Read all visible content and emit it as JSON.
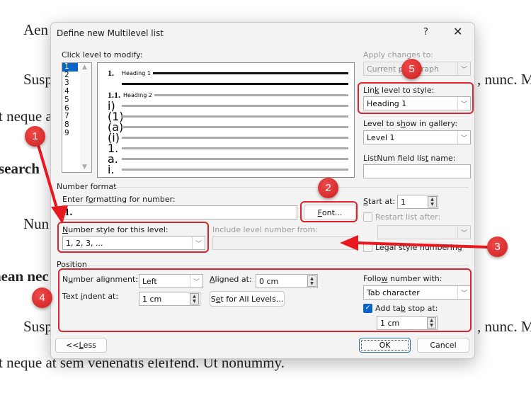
{
  "document": {
    "lines": [
      {
        "text": "Aen",
        "bold": false
      },
      {
        "text": "Susp",
        "bold": false
      },
      {
        "text": ", nunc. M",
        "bold": false
      },
      {
        "text": "t neque a",
        "bold": false
      },
      {
        "text": "search",
        "bold": true
      },
      {
        "text": "Nun",
        "bold": false
      },
      {
        "text": "nean nec",
        "bold": true
      },
      {
        "text": "Susp",
        "bold": false
      },
      {
        "text": ", nunc. M",
        "bold": false
      },
      {
        "text": "t neque at sem venenatis eleifend. Ut nonummy.",
        "bold": false
      }
    ]
  },
  "dialog": {
    "title": "Define new Multilevel list",
    "help_label": "?",
    "close_label": "✕",
    "click_level_label": "Click level to modify:",
    "levels": [
      "1",
      "2",
      "3",
      "4",
      "5",
      "6",
      "7",
      "8",
      "9"
    ],
    "selected_level": "1",
    "preview": [
      {
        "num": "1.",
        "text": "Heading 1",
        "bold": true
      },
      {
        "num": "1.1.",
        "text": "Heading 2",
        "bold": true
      },
      {
        "num": "i)",
        "text": ""
      },
      {
        "num": "(1)",
        "text": ""
      },
      {
        "num": "(a)",
        "text": ""
      },
      {
        "num": "(i)",
        "text": ""
      },
      {
        "num": "1.",
        "text": ""
      },
      {
        "num": "a.",
        "text": ""
      },
      {
        "num": "i.",
        "text": ""
      }
    ],
    "apply_changes_label": "Apply changes to:",
    "apply_changes_value": "Current paragraph",
    "link_level_label": "Link level to style:",
    "link_level_value": "Heading 1",
    "gallery_level_label": "Level to show in gallery:",
    "gallery_level_value": "Level 1",
    "listnum_label": "ListNum field list name:",
    "listnum_value": "",
    "number_format_group": "Number format",
    "enter_formatting_label": "Enter formatting for number:",
    "formatting_value": "1.",
    "font_button": "Font...",
    "number_style_label": "Number style for this level:",
    "number_style_value": "1, 2, 3, ...",
    "include_level_label": "Include level number from:",
    "include_level_value": "",
    "start_at_label": "Start at:",
    "start_at_value": "1",
    "restart_label": "Restart list after:",
    "restart_checked": false,
    "legal_label": "Legal style numbering",
    "legal_checked": false,
    "position_group": "Position",
    "number_alignment_label": "Number alignment:",
    "number_alignment_value": "Left",
    "aligned_at_label": "Aligned at:",
    "aligned_at_value": "0 cm",
    "text_indent_label": "Text indent at:",
    "text_indent_value": "1 cm",
    "set_all_button": "Set for All Levels...",
    "follow_number_label": "Follow number with:",
    "follow_number_value": "Tab character",
    "add_tab_label": "Add tab stop at:",
    "add_tab_checked": true,
    "add_tab_value": "1 cm",
    "less_button": "<< Less",
    "ok_button": "OK",
    "cancel_button": "Cancel"
  },
  "annotations": {
    "badges": [
      "1",
      "2",
      "3",
      "4",
      "5"
    ],
    "color": "#d9252b"
  }
}
